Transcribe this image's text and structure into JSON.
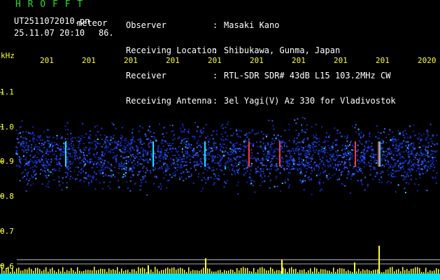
{
  "header": {
    "brand": "H R O F F T",
    "filename": "UT2511072010.pn",
    "mode": "meteor",
    "datetime": "25.11.07 20:10",
    "count": "86."
  },
  "info": [
    {
      "label": "Observer",
      "value": "Masaki Kano"
    },
    {
      "label": "Receiving Location",
      "value": "Shibukawa, Gunma, Japan"
    },
    {
      "label": "Receiver",
      "value": "RTL-SDR SDR# 43dB L15 103.2MHz CW"
    },
    {
      "label": "Receiving Antenna",
      "value": "3el Yagi(V) Az 330 for Vladivostok"
    }
  ],
  "axis": {
    "unit": "kHz",
    "y_ticks": [
      "1.1",
      "1.0",
      "0.9",
      "0.8",
      "0.7",
      "0.6"
    ],
    "x_ticks": [
      "201",
      "201",
      "201",
      "201",
      "201",
      "201",
      "201",
      "201",
      "201",
      "2020"
    ]
  },
  "colors": {
    "background": "#000000",
    "title": "#22dd22",
    "text": "#ffffff",
    "axis": "#ffff33",
    "noise": "#1a3ad8",
    "baseline": "#00e5ff"
  }
}
